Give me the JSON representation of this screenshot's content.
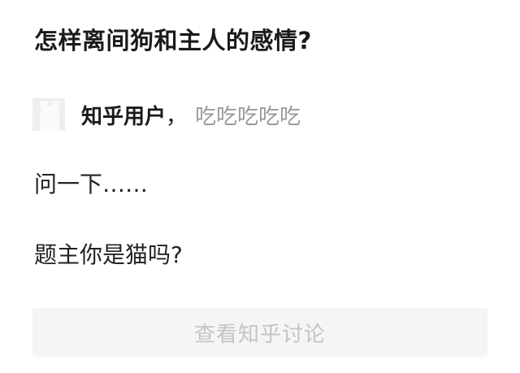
{
  "question": {
    "title": "怎样离间狗和主人的感情?"
  },
  "author": {
    "name": "知乎用户",
    "separator": "，",
    "bio": "吃吃吃吃吃",
    "avatar_icon": "default-avatar-icon"
  },
  "answer": {
    "lines": [
      "问一下……",
      "题主你是猫吗?"
    ]
  },
  "actions": {
    "view_discussion_label": "查看知乎讨论"
  },
  "colors": {
    "background": "#ffffff",
    "title_text": "#1a1a1a",
    "bio_text": "#9a9a9a",
    "button_bg": "#f5f5f5",
    "button_text": "#c4c4c4"
  }
}
